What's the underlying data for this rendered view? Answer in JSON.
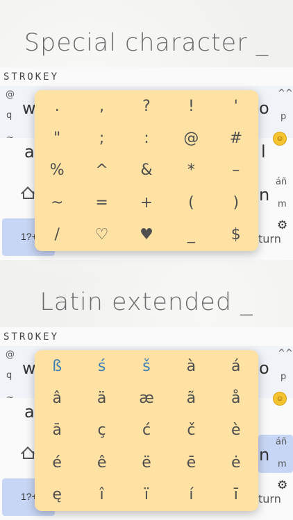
{
  "headings": {
    "special": "Special character _",
    "latin": "Latin extended _"
  },
  "keyboard": {
    "brand": "STROKEY",
    "top_left_small": "@",
    "row1_left_small": "q",
    "row1_left_big": "w",
    "row1_right_big": "o",
    "row1_right_small": "p",
    "row1_right_top": "^^",
    "row2_left_small": "~",
    "row2_left_big": "a",
    "row2_right_big": "l",
    "emoji_label": "smiley",
    "row3_right_big": "n",
    "row3_right_top": "áñ",
    "row3_right_small": "m",
    "row4_left_label": "1?+",
    "row4_right_label": "turn"
  },
  "special_chars": [
    ".",
    ",",
    "?",
    "!",
    "'",
    "\"",
    ";",
    ":",
    "@",
    "#",
    "%",
    "^",
    "&",
    "*",
    "–",
    "~",
    "=",
    "+",
    "(",
    ")",
    "/",
    "♡",
    "♥",
    "_",
    "$"
  ],
  "latin_chars": [
    "ß",
    "ś",
    "š",
    "à",
    "á",
    "â",
    "ä",
    "æ",
    "ã",
    "å",
    "ā",
    "ç",
    "ć",
    "č",
    "è",
    "é",
    "ê",
    "ë",
    "ē",
    "ė",
    "ę",
    "î",
    "ï",
    "í",
    "ī"
  ],
  "colors": {
    "popup": "#fde2a4",
    "highlight": "#3e7fb6",
    "blue_key": "#c8d6f5"
  }
}
